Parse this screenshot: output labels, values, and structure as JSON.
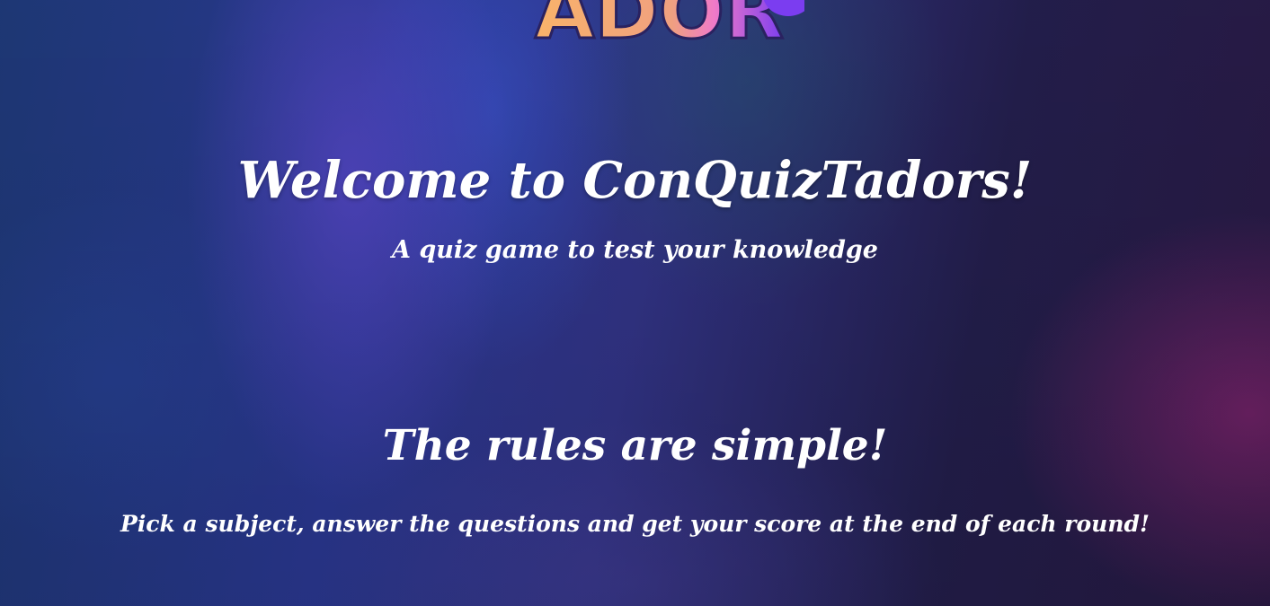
{
  "logo": {
    "partial_text": "ADOR",
    "colors": {
      "orange": "#f8b36a",
      "pink": "#f07ac8",
      "purple": "#7b3df0"
    }
  },
  "hero": {
    "title": "Welcome to ConQuizTadors!",
    "tagline": "A quiz game to test your knowledge"
  },
  "rules": {
    "title": "The rules are simple!",
    "text": "Pick a subject, answer the questions and get your score at the end of each round!"
  }
}
